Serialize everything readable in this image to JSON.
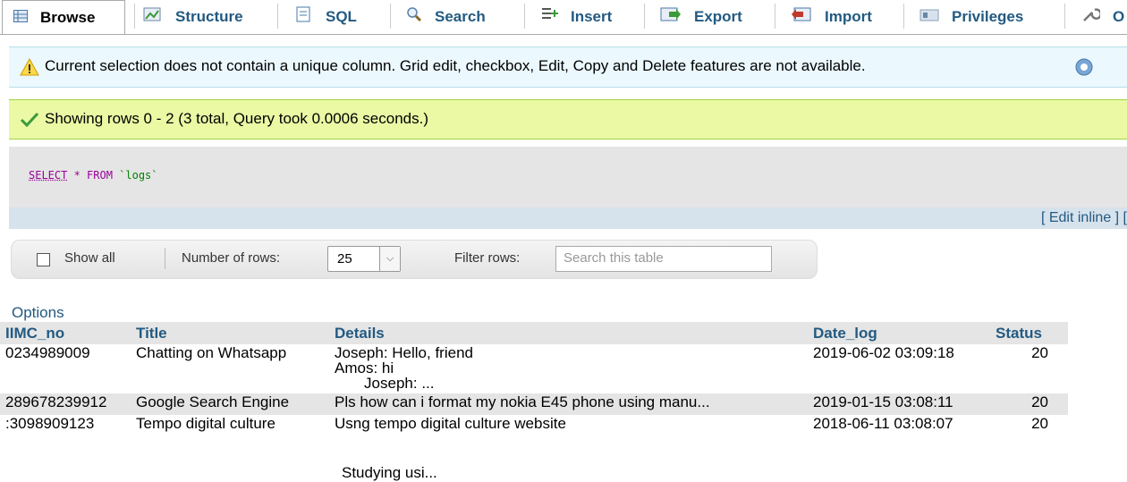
{
  "tabs": [
    {
      "label": "Browse",
      "icon": "table-icon",
      "active": true
    },
    {
      "label": "Structure",
      "icon": "structure-icon"
    },
    {
      "label": "SQL",
      "icon": "sql-icon"
    },
    {
      "label": "Search",
      "icon": "search-icon"
    },
    {
      "label": "Insert",
      "icon": "insert-icon"
    },
    {
      "label": "Export",
      "icon": "export-icon"
    },
    {
      "label": "Import",
      "icon": "import-icon"
    },
    {
      "label": "Privileges",
      "icon": "privileges-icon"
    },
    {
      "label": "O",
      "icon": "wrench-icon"
    }
  ],
  "notice": {
    "text": "Current selection does not contain a unique column. Grid edit, checkbox, Edit, Copy and Delete features are not available.",
    "icon": "warning-icon"
  },
  "success": {
    "text": "Showing rows 0 - 2 (3 total, Query took 0.0006 seconds.)",
    "icon": "checkmark-icon"
  },
  "sql": {
    "kw1": "SELECT",
    "mid": " * FROM ",
    "table": "`logs`"
  },
  "editbar": {
    "text": "[ Edit inline ] ["
  },
  "nav": {
    "show_all": "Show all",
    "rows_label": "Number of rows:",
    "rows_value": "25",
    "filter_label": "Filter rows:",
    "filter_placeholder": "Search this table"
  },
  "options_label": "Options",
  "columns": [
    "IIMC_no",
    "Title",
    "Details",
    "Date_log",
    "Status"
  ],
  "rows": [
    {
      "id": "0234989009",
      "title": "Chatting on Whatsapp",
      "details": [
        "Joseph:  Hello, friend",
        "Amos: hi",
        "       Joseph: ..."
      ],
      "date": "2019-06-02 03:09:18",
      "status": "20"
    },
    {
      "id": "289678239912",
      "title": "Google Search Engine",
      "details": [
        "Pls how can i format my nokia E45 phone using manu..."
      ],
      "date": "2019-01-15 03:08:11",
      "status": "20"
    },
    {
      "id": ":3098909123",
      "title": "Tempo digital culture",
      "details": [
        "Usng tempo digital culture website",
        "Studying usi..."
      ],
      "date": "2018-06-11 03:08:07",
      "status": "20"
    }
  ],
  "colors": {
    "link": "#235a81",
    "notice_bg": "#ebf8fd",
    "success_bg": "#ebf8a4"
  }
}
